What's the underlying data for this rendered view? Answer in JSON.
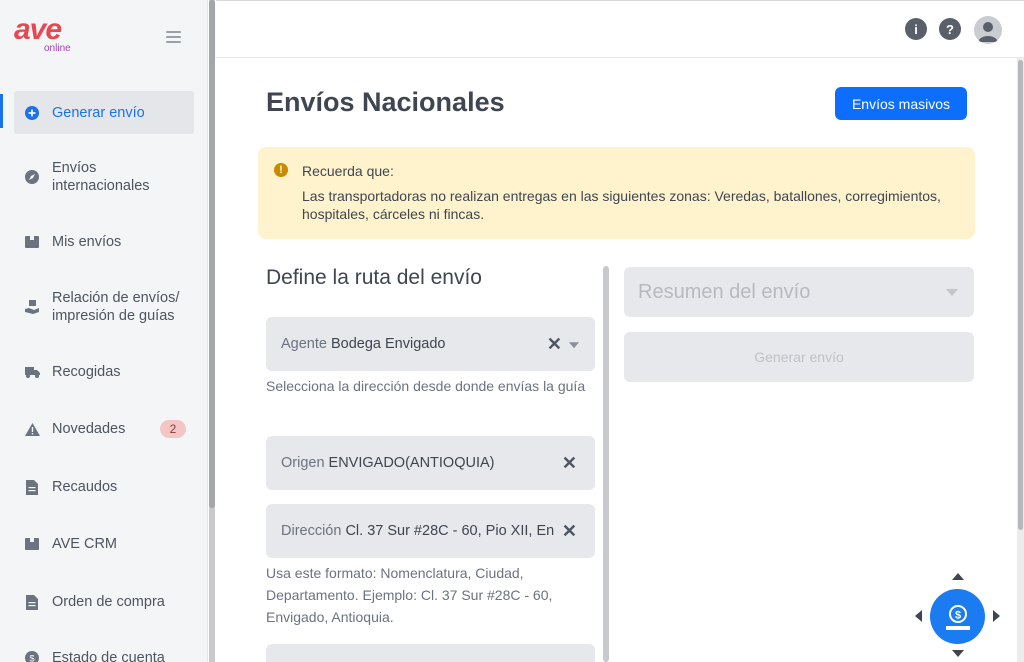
{
  "brand": {
    "name": "ave",
    "sub": "online"
  },
  "sidebar": {
    "items": [
      {
        "label": "Generar envío",
        "icon": "plus-circle-icon",
        "active": true
      },
      {
        "label": "Envíos internacionales",
        "icon": "compass-icon"
      },
      {
        "label": "Mis envíos",
        "icon": "box-icon"
      },
      {
        "label": "Relación de envíos/ impresión de guías",
        "icon": "hand-box-icon"
      },
      {
        "label": "Recogidas",
        "icon": "truck-icon"
      },
      {
        "label": "Novedades",
        "icon": "warning-icon",
        "badge": "2"
      },
      {
        "label": "Recaudos",
        "icon": "document-icon"
      },
      {
        "label": "AVE CRM",
        "icon": "box-icon"
      },
      {
        "label": "Orden de compra",
        "icon": "document-icon"
      },
      {
        "label": "Estado de cuenta",
        "icon": "dollar-circle-icon"
      }
    ]
  },
  "topbar": {
    "icons": [
      "info-icon",
      "help-icon",
      "user-avatar-icon"
    ]
  },
  "main": {
    "title": "Envíos Nacionales",
    "bulk_button": "Envíos masivos",
    "alert": {
      "title": "Recuerda que:",
      "text": "Las transportadoras no realizan entregas en las siguientes zonas: Veredas, batallones, corregimientos, hospitales, cárceles ni fincas."
    },
    "route_title": "Define la ruta del envío",
    "fields": {
      "agent": {
        "label": "Agente",
        "value": "Bodega Envigado"
      },
      "agent_help": "Selecciona la dirección desde donde envías la guía",
      "origin": {
        "label": "Origen",
        "value": "ENVIGADO(ANTIOQUIA)"
      },
      "address": {
        "label": "Dirección",
        "value": "Cl. 37 Sur #28C - 60, Pio XII, En"
      },
      "address_help": "Usa este formato: Nomenclatura, Ciudad, Departamento. Ejemplo: Cl. 37 Sur #28C - 60, Envigado, Antioquia."
    },
    "summary_label": "Resumen del envío",
    "generate_button": "Generar envío"
  },
  "colors": {
    "primary": "#0d6efd",
    "brand_red": "#e8474f",
    "alert_bg": "#fff3cd"
  }
}
